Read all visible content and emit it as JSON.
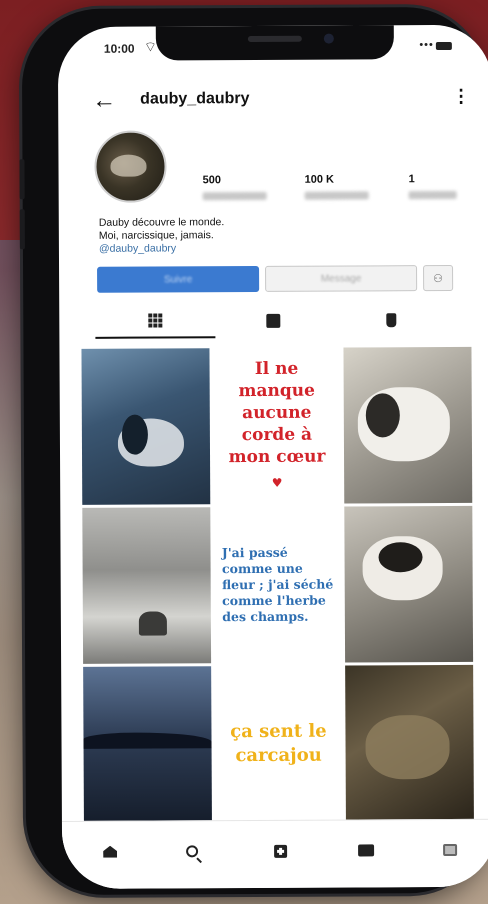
{
  "status_bar": {
    "time": "10:00",
    "wifi_icon": "wifi-icon",
    "signal_text": "•••",
    "battery_icon": "battery-icon"
  },
  "header": {
    "back_icon": "back-arrow-icon",
    "username": "dauby_daubry",
    "more_icon": "more-options-icon"
  },
  "profile": {
    "stats": [
      {
        "value": "500"
      },
      {
        "value": "100 K"
      },
      {
        "value": "1"
      }
    ],
    "bio_line1": "Dauby découvre le monde.",
    "bio_line2": "Moi, narcissique, jamais.",
    "bio_link": "@dauby_daubry"
  },
  "actions": {
    "follow_label": "Suivre",
    "message_label": "Message",
    "suggest_icon": "add-person-icon"
  },
  "tabs": [
    {
      "icon": "grid-icon",
      "active": true
    },
    {
      "icon": "reels-icon",
      "active": false
    },
    {
      "icon": "tagged-icon",
      "active": false
    }
  ],
  "posts": {
    "quote1": [
      "Il ne",
      "manque",
      "aucune",
      "corde à",
      "mon cœur"
    ],
    "quote1_icon": "heart-icon",
    "quote2": [
      "J'ai passé",
      "comme une",
      "fleur ; j'ai séché",
      "comme l'herbe",
      "des champs."
    ],
    "quote3": [
      "ça sent le",
      "carcajou"
    ],
    "colors": {
      "quote1": "#d2232a",
      "quote2": "#2f6fb2",
      "quote3": "#f0b21a"
    }
  },
  "bottom_nav": [
    {
      "icon": "home-icon"
    },
    {
      "icon": "search-icon"
    },
    {
      "icon": "create-post-icon"
    },
    {
      "icon": "reels-icon"
    },
    {
      "icon": "profile-thumbnail-icon"
    }
  ]
}
